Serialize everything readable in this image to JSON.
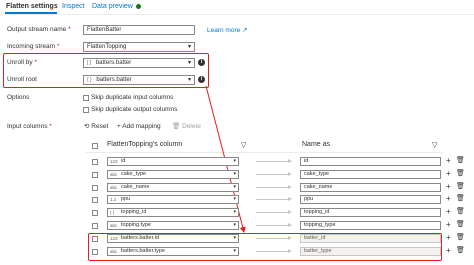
{
  "tabs": [
    {
      "label": "Flatten settings"
    },
    {
      "label": "Inspect"
    },
    {
      "label": "Data preview"
    }
  ],
  "colors": {
    "accent": "#0078d4",
    "status_dot": "#107c10",
    "highlight": "#e0201b"
  },
  "form": {
    "output_stream": {
      "label": "Output stream name",
      "value": "FlattenBatter"
    },
    "incoming_stream": {
      "label": "Incoming stream",
      "value": "FlattenTopping"
    },
    "unroll_by": {
      "label": "Unroll by",
      "type_icon": "[ ]",
      "value": "batters.batter"
    },
    "unroll_root": {
      "label": "Unroll root",
      "type_icon": "{ }",
      "value": "batters.batter"
    },
    "learn_more": "Learn more",
    "options": {
      "label": "Options",
      "skip_input": "Skip duplicate input columns",
      "skip_output": "Skip duplicate output columns"
    },
    "input_columns": {
      "label": "Input columns"
    }
  },
  "toolbar": {
    "reset": "Reset",
    "add_mapping": "Add mapping",
    "delete": "Delete"
  },
  "mapping": {
    "source_header": "FlattenTopping's column",
    "name_header": "Name as",
    "rows": [
      {
        "type": "123",
        "source": "id",
        "name": "id"
      },
      {
        "type": "abc",
        "source": "cake_type",
        "name": "cake_type"
      },
      {
        "type": "abc",
        "source": "cake_name",
        "name": "cake_name"
      },
      {
        "type": "1.2",
        "source": "ppu",
        "name": "ppu"
      },
      {
        "type": "{ }",
        "source": "topping_id",
        "name": "topping_id"
      },
      {
        "type": "abc",
        "source": "topping.type",
        "name": "topping_type"
      },
      {
        "type": "123",
        "source": "batters.batter.id",
        "name": "batter_id"
      },
      {
        "type": "abc",
        "source": "batters.batter.type",
        "name": "batter_type"
      }
    ]
  }
}
